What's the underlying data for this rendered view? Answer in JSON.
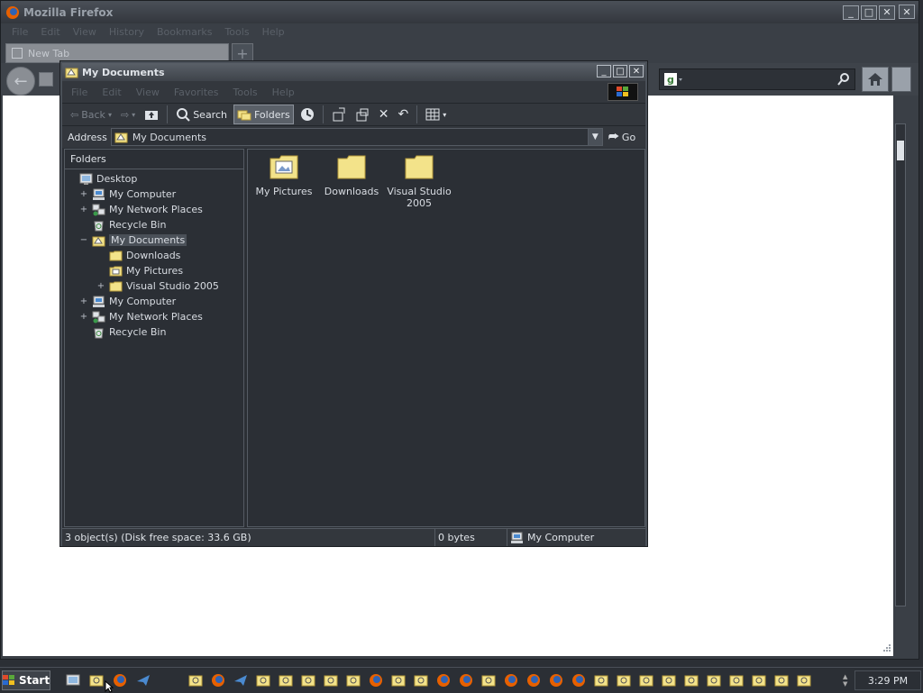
{
  "firefox": {
    "title": "Mozilla Firefox",
    "menu": [
      "File",
      "Edit",
      "View",
      "History",
      "Bookmarks",
      "Tools",
      "Help"
    ],
    "tab_label": "New Tab",
    "new_tab_symbol": "+"
  },
  "explorer": {
    "title": "My Documents",
    "menu": [
      "File",
      "Edit",
      "View",
      "Favorites",
      "Tools",
      "Help"
    ],
    "toolbar": {
      "back": "Back",
      "search": "Search",
      "folders": "Folders"
    },
    "address": {
      "label": "Address",
      "value": "My Documents",
      "go": "Go"
    },
    "folders_pane": {
      "header": "Folders",
      "tree": [
        {
          "label": "Desktop",
          "expander": "",
          "icon": "desktop-icon"
        },
        {
          "label": "My Computer",
          "expander": "+",
          "icon": "computer-icon"
        },
        {
          "label": "My Network Places",
          "expander": "+",
          "icon": "network-icon"
        },
        {
          "label": "Recycle Bin",
          "expander": "",
          "icon": "recycle-bin-icon"
        },
        {
          "label": "My Documents",
          "expander": "−",
          "icon": "my-documents-icon",
          "selected": true
        },
        {
          "label": "Downloads",
          "expander": "",
          "icon": "folder-icon"
        },
        {
          "label": "My Pictures",
          "expander": "",
          "icon": "pictures-folder-icon"
        },
        {
          "label": "Visual Studio 2005",
          "expander": "+",
          "icon": "folder-icon"
        },
        {
          "label": "My Computer",
          "expander": "+",
          "icon": "computer-icon"
        },
        {
          "label": "My Network Places",
          "expander": "+",
          "icon": "network-icon"
        },
        {
          "label": "Recycle Bin",
          "expander": "",
          "icon": "recycle-bin-icon"
        }
      ]
    },
    "items": [
      {
        "label": "My Pictures",
        "icon": "pictures-folder-icon"
      },
      {
        "label": "Downloads",
        "icon": "folder-icon"
      },
      {
        "label": "Visual Studio 2005",
        "icon": "folder-icon"
      }
    ],
    "status": {
      "objects": "3 object(s) (Disk free space: 33.6 GB)",
      "size": "0 bytes",
      "zone": "My Computer"
    }
  },
  "taskbar": {
    "start": "Start",
    "clock": "3:29 PM"
  },
  "colors": {
    "folder": "#f3e38a",
    "window_bg": "#2b2f35",
    "selection": "#4a5058"
  }
}
